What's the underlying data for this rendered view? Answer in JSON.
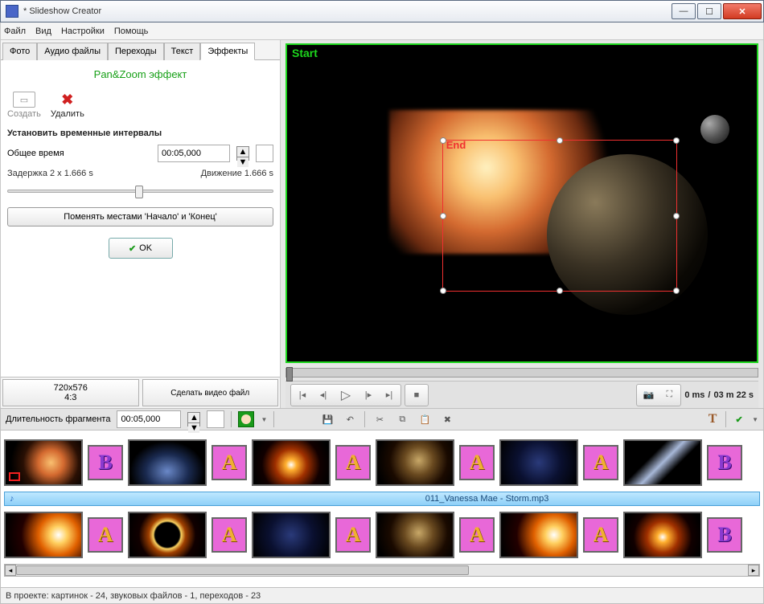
{
  "window": {
    "title": "* Slideshow Creator"
  },
  "menu": {
    "file": "Файл",
    "view": "Вид",
    "settings": "Настройки",
    "help": "Помощь"
  },
  "tabs": {
    "photo": "Фото",
    "audio": "Аудио файлы",
    "transitions": "Переходы",
    "text": "Текст",
    "effects": "Эффекты"
  },
  "effects": {
    "title": "Pan&Zoom эффект",
    "create": "Создать",
    "delete": "Удалить",
    "section": "Установить временные интервалы",
    "total_time_label": "Общее время",
    "total_time_value": "00:05,000",
    "delay_label": "Задержка 2 x 1.666 s",
    "motion_label": "Движение 1.666 s",
    "swap_button": "Поменять местами 'Начало' и 'Конец'",
    "ok": "OK",
    "resolution": "720x576",
    "aspect": "4:3",
    "make_video": "Сделать видео файл"
  },
  "preview": {
    "start": "Start",
    "end": "End",
    "pos": "0 ms",
    "sep": "/",
    "dur": "03 m 22 s"
  },
  "timeline_bar": {
    "duration_label": "Длительность фрагмента",
    "duration_value": "00:05,000"
  },
  "audio": {
    "filename": "011_Vanessa Mae - Storm.mp3"
  },
  "status": {
    "text": "В проекте: картинок - 24, звуковых файлов - 1, переходов - 23"
  }
}
